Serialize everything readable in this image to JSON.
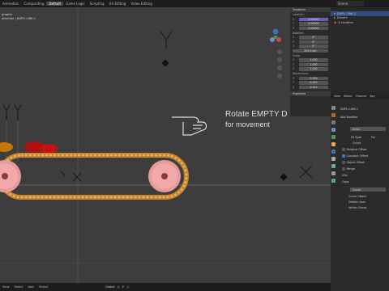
{
  "topbar": {
    "workspaces": [
      "Animation",
      "Compositing",
      "Default",
      "Game Logic",
      "Scripting",
      "UV Editing",
      "Video Editing"
    ],
    "active": "Default",
    "scene": "Scene"
  },
  "viewport": {
    "title_line1": "graphic",
    "title_line2": "ollection | DUPLI LINK.1",
    "overlay_text_line1": "Rotate EMPTY D",
    "overlay_text_line2": "for movement"
  },
  "npanel": {
    "header": "Transform",
    "location_label": "Location:",
    "location": [
      {
        "k": "X",
        "v": "0.00000"
      },
      {
        "k": "Y",
        "v": "0.00000"
      },
      {
        "k": "Z",
        "v": "0.00000"
      }
    ],
    "rotation_label": "Rotation:",
    "rotation": [
      {
        "k": "X",
        "v": "0°"
      },
      {
        "k": "Y",
        "v": "0°"
      },
      {
        "k": "Z",
        "v": "0°"
      }
    ],
    "mode": "XYZ Euler",
    "scale_label": "Scale:",
    "scale": [
      {
        "k": "X",
        "v": "1.000"
      },
      {
        "k": "Y",
        "v": "1.000"
      },
      {
        "k": "Z",
        "v": "1.000"
      }
    ],
    "dimensions_label": "Dimensions:",
    "dimensions": [
      {
        "k": "X",
        "v": "0.150"
      },
      {
        "k": "Y",
        "v": "0.020"
      },
      {
        "k": "Z",
        "v": "0.014"
      }
    ],
    "properties": "Properties"
  },
  "outliner": {
    "items": [
      {
        "label": "DUPLI LINK.1",
        "sel": true
      },
      {
        "label": "Drivers",
        "sel": false
      },
      {
        "label": "X Location",
        "sel": false
      }
    ]
  },
  "props": {
    "tabs": [
      "View",
      "Select",
      "Channel",
      "Key"
    ],
    "object": "DUPLI LINK.1",
    "add_modifier": "Add Modifier",
    "array": "Array",
    "fit_type_label": "Fit Type",
    "fit_type": "Fix",
    "count_label": "Count",
    "relative_offset": "Relative Offset",
    "constant_offset": "Constant Offset",
    "object_offset": "Object Offset",
    "merge": "Merge",
    "uvs": "UVs",
    "caps": "Caps",
    "curve": "Curve",
    "curve_object_label": "Curve Object",
    "deform_axis_label": "Deform Axis",
    "vertex_group_label": "Vertex Group"
  },
  "status": {
    "items": [
      "View",
      "Select",
      "Add",
      "Object"
    ],
    "mode": "Global"
  }
}
